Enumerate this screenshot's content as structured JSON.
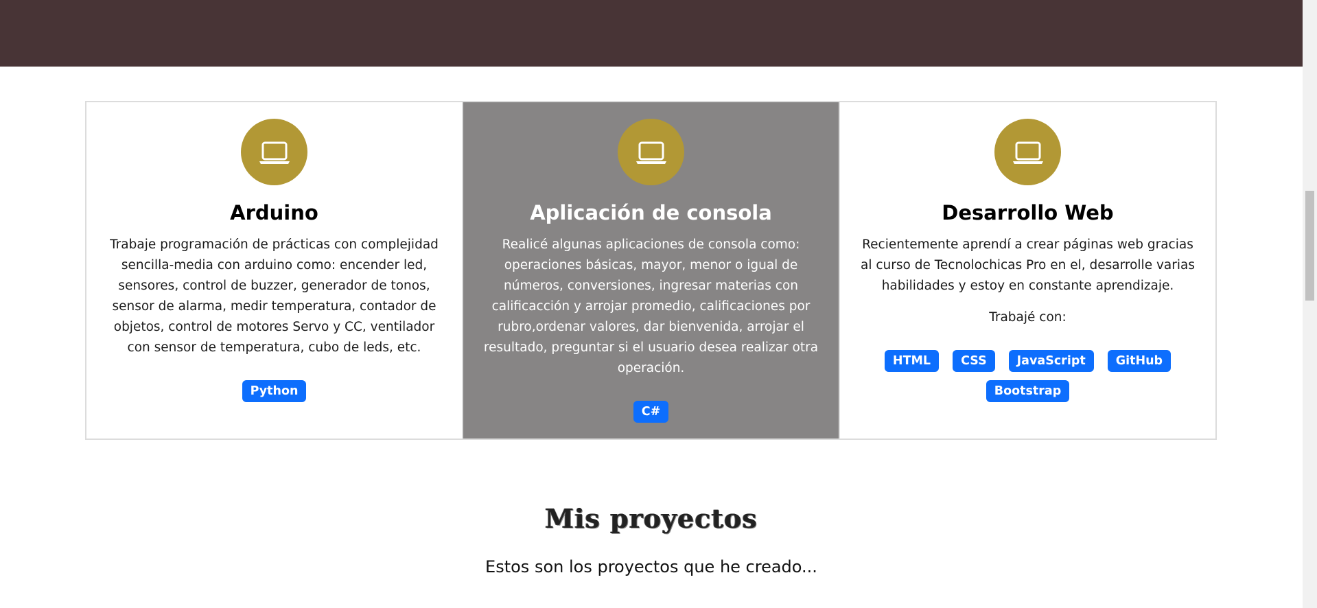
{
  "cards": [
    {
      "title": "Arduino",
      "text": "Trabaje programación de prácticas con complejidad sencilla-media con arduino como: encender led, sensores, control de buzzer, generador de tonos, sensor de alarma, medir temperatura, contador de objetos, control de motores Servo y CC, ventilador con sensor de temperatura, cubo de leds, etc.",
      "icon": "laptop-icon",
      "badges": [
        "Python"
      ]
    },
    {
      "title": "Aplicación de consola",
      "text": "Realicé algunas aplicaciones de consola como: operaciones básicas, mayor, menor o igual de números, conversiones, ingresar materias con calificacción y arrojar promedio, calificaciones por rubro,ordenar valores, dar bienvenida, arrojar el resultado, preguntar si el usuario desea realizar otra operación.",
      "icon": "laptop-icon",
      "badges": [
        "C#"
      ]
    },
    {
      "title": "Desarrollo Web",
      "text": "Recientemente aprendí a crear páginas web gracias al curso de Tecnolochicas Pro en el, desarrolle varias habilidades y estoy en constante aprendizaje.",
      "subtext": "Trabajé con:",
      "icon": "laptop-icon",
      "badges": [
        "HTML",
        "CSS",
        "JavaScript",
        "GitHub",
        "Bootstrap"
      ]
    }
  ],
  "projects": {
    "title": "Mis proyectos",
    "subtitle": "Estos son los proyectos que he creado..."
  },
  "colors": {
    "header": "#483436",
    "icon_circle": "#b29835",
    "active_card": "#878585",
    "badge": "#0d6efd"
  }
}
